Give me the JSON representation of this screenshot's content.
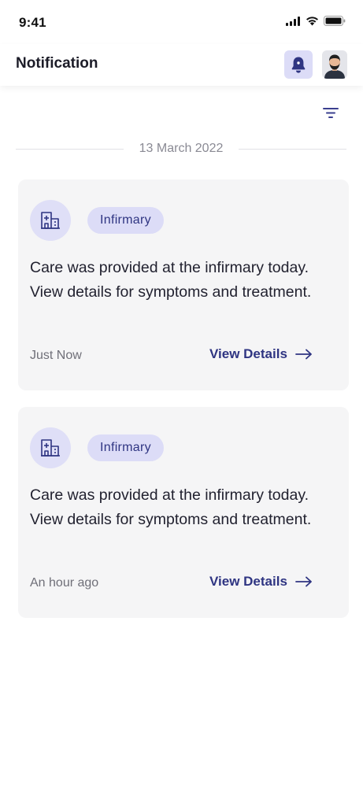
{
  "status_bar": {
    "time": "9:41"
  },
  "app_bar": {
    "title": "Notification"
  },
  "divider": {
    "date": "13 March 2022"
  },
  "notifications": [
    {
      "tag": "Infirmary",
      "message": "Care was provided at the infirmary today. View details for symptoms and treatment.",
      "time": "Just Now",
      "action_label": "View Details"
    },
    {
      "tag": "Infirmary",
      "message": "Care was provided at the infirmary today. View details for symptoms and treatment.",
      "time": "An hour ago",
      "action_label": "View Details"
    }
  ],
  "icons": {
    "bell": "bell-icon",
    "avatar": "avatar",
    "filter": "filter-icon",
    "card_icon": "hospital-icon",
    "arrow": "arrow-right-icon"
  },
  "colors": {
    "accent": "#2f3582",
    "accent_light": "#dcdcf7",
    "card_bg": "#f5f5f6",
    "muted_text": "#8a8a94"
  }
}
